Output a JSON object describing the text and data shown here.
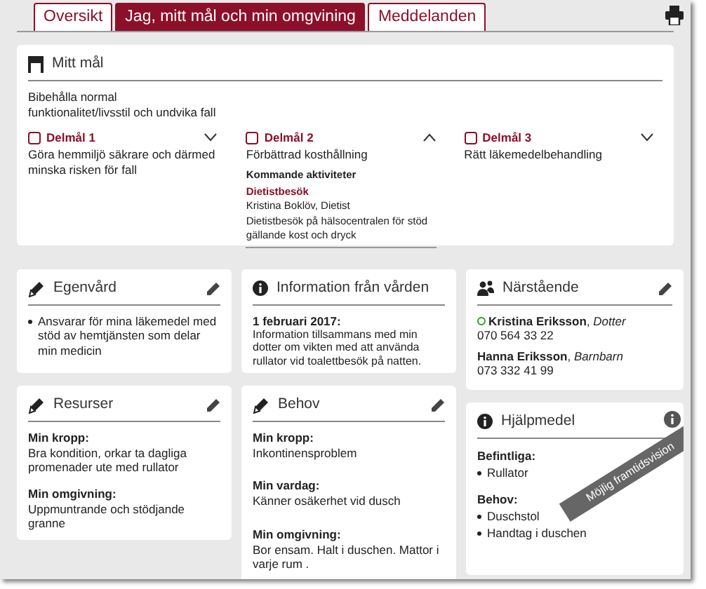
{
  "tabs": [
    {
      "label": "Oversikt",
      "selected": false
    },
    {
      "label": "Jag, mitt mål och min omgvining",
      "selected": true
    },
    {
      "label": "Meddelanden",
      "selected": false
    }
  ],
  "goal": {
    "title": "Mitt mål",
    "text": "Bibehålla normal\nfunktionalitet/livsstil och undvika fall",
    "subgoals": [
      {
        "label": "Delmål 1",
        "text": "Göra hemmiljö säkrare och därmed minska risken för fall",
        "checked": false,
        "expanded": false
      },
      {
        "label": "Delmål 2",
        "text": "Förbättrad kosthållning",
        "checked": false,
        "expanded": true,
        "activities_heading": "Kommande aktiviteter",
        "activities": [
          {
            "title": "Dietistbesök",
            "person": "Kristina Boklöv, Dietist",
            "text": "Dietistbesök på hälsocentralen för stöd gällande kost och dryck"
          }
        ]
      },
      {
        "label": "Delmål 3",
        "text": "Rätt läkemedelbehandling",
        "checked": false,
        "expanded": false
      }
    ]
  },
  "egenvard": {
    "title": "Egenvård",
    "items": [
      "Ansvarar för mina läkemedel med stöd av hemtjänsten som delar min medicin"
    ]
  },
  "information": {
    "title": "Information från vården",
    "date": "1 februari 2017:",
    "text": "Information tillsammans med min dotter om vikten med att använda rullator vid toalettbesök på natten."
  },
  "narstaende": {
    "title": "Närstående",
    "contacts": [
      {
        "name": "**Kristina Eriksson**, *Dotter*",
        "phone": "070 564 33 22",
        "marked": true
      },
      {
        "name": "**Hanna Eriksson**, *Barnbarn*",
        "phone": "073 332 41 99",
        "marked": false
      }
    ]
  },
  "resurser": {
    "title": "Resurser",
    "sections": [
      {
        "heading": "Min kropp:",
        "text": "Bra kondition, orkar ta dagliga promenader ute med rullator"
      },
      {
        "heading": "Min omgivning:",
        "text": "Uppmuntrande och stödjande granne"
      }
    ]
  },
  "behov": {
    "title": "Behov",
    "sections": [
      {
        "heading": "Min kropp:",
        "text": "Inkontinensproblem"
      },
      {
        "heading": "Min vardag:",
        "text": "Känner osäkerhet vid dusch"
      },
      {
        "heading": "Min omgivning:",
        "text": "Bor ensam. Halt i duschen. Mattor i varje rum ."
      }
    ]
  },
  "hjalpmedel": {
    "title": "Hjälpmedel",
    "groups": [
      {
        "heading": "Befintliga:",
        "items": [
          "Rullator"
        ]
      },
      {
        "heading": "Behov:",
        "items": [
          "Duschstol",
          "Handtag i duschen"
        ]
      }
    ],
    "banner": "Möjlig framtidsvision"
  }
}
